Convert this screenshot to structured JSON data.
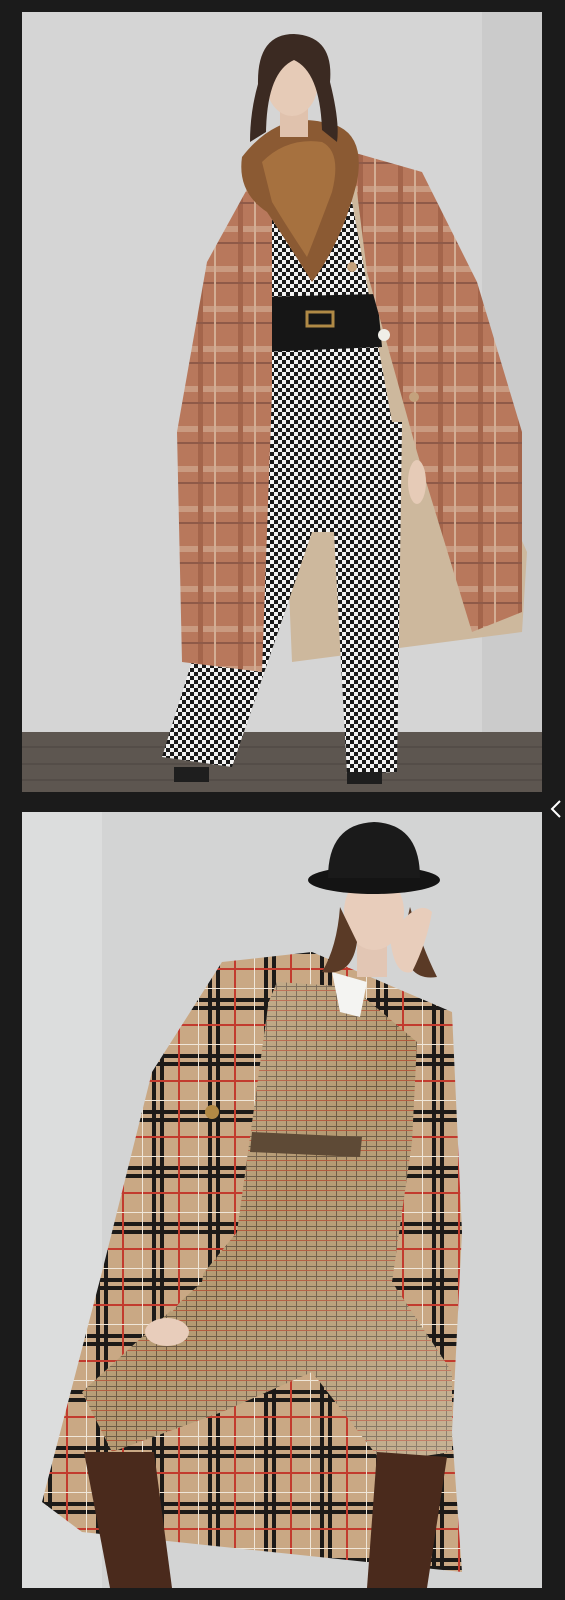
{
  "gallery": {
    "photos": [
      {
        "name": "model-in-plaid-coat-houndstooth-suit"
      },
      {
        "name": "model-in-check-coat-bowler-hat"
      }
    ],
    "nav": {
      "icon": "chevron-left-icon"
    },
    "colors": {
      "background": "#1b1b1b",
      "studio_wall": "#d3d3d3",
      "floor": "#5a5550",
      "arrow": "#ffffff"
    }
  }
}
